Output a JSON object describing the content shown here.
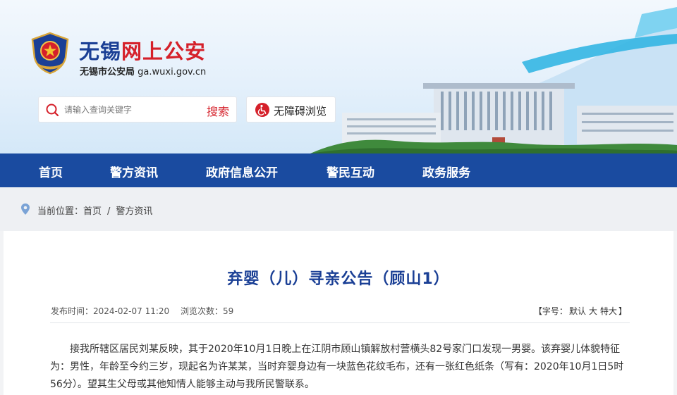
{
  "header": {
    "title_part1": "无锡",
    "title_part2": "网上公安",
    "subtitle_org": "无锡市公安局",
    "subtitle_domain": "ga.wuxi.gov.cn",
    "logo_icon": "police-emblem-icon",
    "search": {
      "placeholder": "请输入查询关键字",
      "button_label": "搜索",
      "icon": "search-icon"
    },
    "accessibility": {
      "label": "无障碍浏览",
      "icon": "wheelchair-icon"
    }
  },
  "nav": {
    "items": [
      {
        "label": "首页"
      },
      {
        "label": "警方资讯"
      },
      {
        "label": "政府信息公开"
      },
      {
        "label": "警民互动"
      },
      {
        "label": "政务服务"
      }
    ]
  },
  "breadcrumb": {
    "icon": "location-pin-icon",
    "prefix": "当前位置：",
    "items": [
      "首页",
      "警方资讯"
    ],
    "separator": "/"
  },
  "article": {
    "title": "弃婴（儿）寻亲公告（顾山1）",
    "publish_label": "发布时间：",
    "publish_time": "2024-02-07 11:20",
    "views_label": "浏览次数：",
    "views": "59",
    "font_size_prefix": "【字号：",
    "font_size_options": [
      "默认",
      "大",
      "特大"
    ],
    "font_size_suffix": "】",
    "body": "接我所辖区居民刘某反映，其于2020年10月1日晚上在江阴市顾山镇解放村营横头82号家门口发现一男婴。该弃婴儿体貌特征为：男性，年龄至今约三岁，现起名为许某某，当时弃婴身边有一块蓝色花纹毛布，还有一张红色纸条（写有：2020年10月1日5时56分）。望其生父母或其他知情人能够主动与我所民警联系。"
  },
  "colors": {
    "brand_blue": "#1a4ba0",
    "brand_red": "#d5202a",
    "title_blue": "#1a3f95"
  }
}
